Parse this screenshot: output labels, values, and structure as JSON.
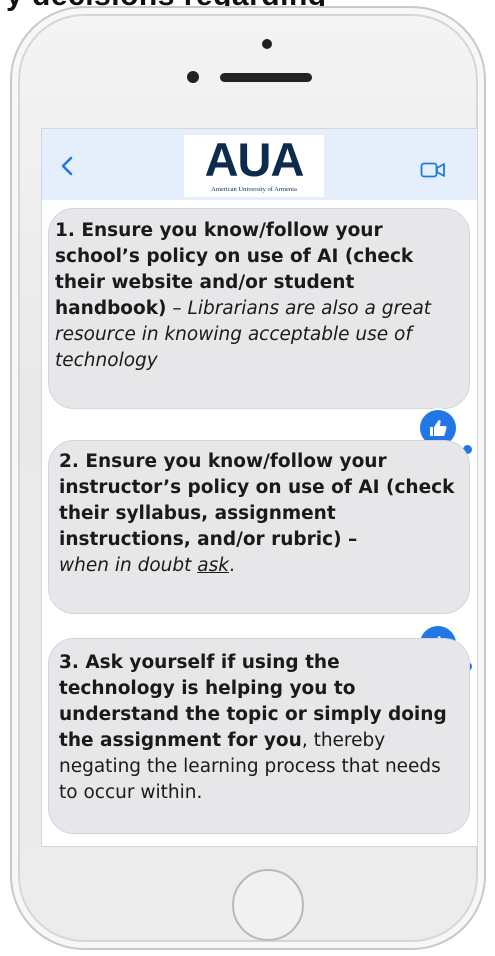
{
  "top_caption": "y decisions regarding",
  "header": {
    "back_icon": "chevron-left-icon",
    "logo_text": "AUA",
    "logo_subtitle": "American University of Armenia",
    "video_icon": "video-camera-icon",
    "accent": "#2277e6",
    "bar_color": "#e5eefb"
  },
  "messages": [
    {
      "bold": "1. Ensure you know/follow your school’s policy on use of AI (check their website and/or student handbook)",
      "sep": " – ",
      "italic": "Librarians are also a great resource in knowing acceptable use of technology",
      "reaction": "thumbs-up-icon"
    },
    {
      "bold": "2. Ensure you know/follow your instructor’s policy on use of AI (check their syllabus, assignment instructions, and/or rubric) –",
      "italic_lead": "when in doubt ",
      "italic_underlined": "ask",
      "end": ".",
      "reaction": "thumbs-up-icon"
    },
    {
      "bold": "3. Ask yourself if using the technology is helping you to understand the topic or simply doing the assignment for you",
      "regular": ", thereby negating the learning process that needs to occur within.",
      "reaction": "none"
    }
  ]
}
